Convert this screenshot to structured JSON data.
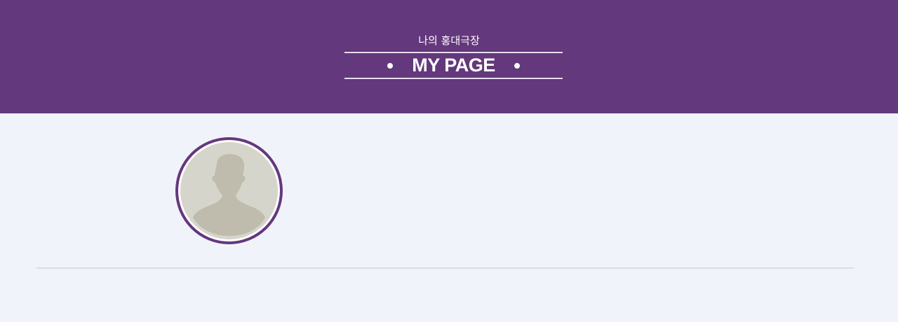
{
  "header": {
    "subtitle": "나의 홍대극장",
    "title": "MY PAGE"
  },
  "profile": {
    "avatar_icon": "default-user-silhouette-icon"
  },
  "colors": {
    "brand": "#64387c",
    "background": "#f1f3fb",
    "avatar_bg": "#d6d5cb",
    "avatar_silhouette": "#bfbcae"
  }
}
